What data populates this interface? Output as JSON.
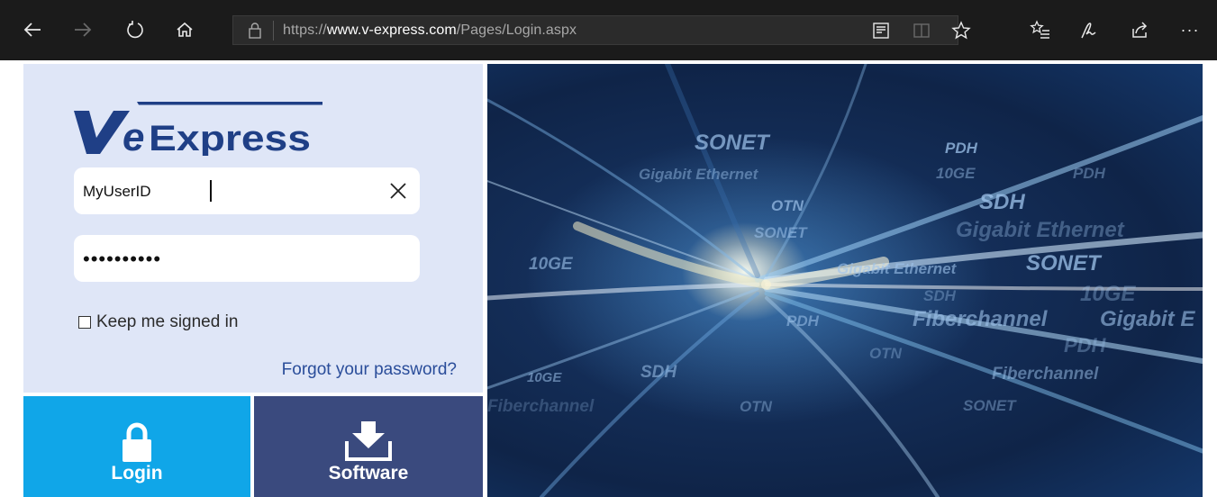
{
  "browser": {
    "url_prefix": "https://",
    "url_host": "www.v-express.com",
    "url_path": "/Pages/Login.aspx",
    "buttons": [
      "back-icon",
      "forward-icon",
      "refresh-icon",
      "home-icon",
      "reader-view-icon",
      "book-icon",
      "favorite-star-icon",
      "favorites-list-icon",
      "pen-icon",
      "share-icon",
      "more-icon"
    ],
    "more_label": "···"
  },
  "login": {
    "logo_text": "VeExpress",
    "userid_value": "MyUserID",
    "password_value": "••••••••••",
    "keep_signed_in_label": "Keep me signed in",
    "forgot_label": "Forgot your password?",
    "login_label": "Login",
    "software_label": "Software"
  },
  "hero": {
    "words": [
      "SONET",
      "PDH",
      "Gigabit Ethernet",
      "10GE",
      "PDH",
      "OTN",
      "SDH",
      "SONET",
      "Gigabit Ethernet",
      "10GE",
      "Gigabit Ethernet",
      "SONET",
      "SDH",
      "10GE",
      "PDH",
      "Fiberchannel",
      "Gigabit E",
      "OTN",
      "PDH",
      "10GE",
      "SDH",
      "Fiberchannel",
      "OTN",
      "SONET",
      "Fiberchannel"
    ]
  },
  "colors": {
    "panel": "#dfe6f7",
    "login_tile": "#10a6e8",
    "software_tile": "#3a4a7e",
    "logo_blue": "#1f3f86",
    "link": "#2a4d9a"
  }
}
